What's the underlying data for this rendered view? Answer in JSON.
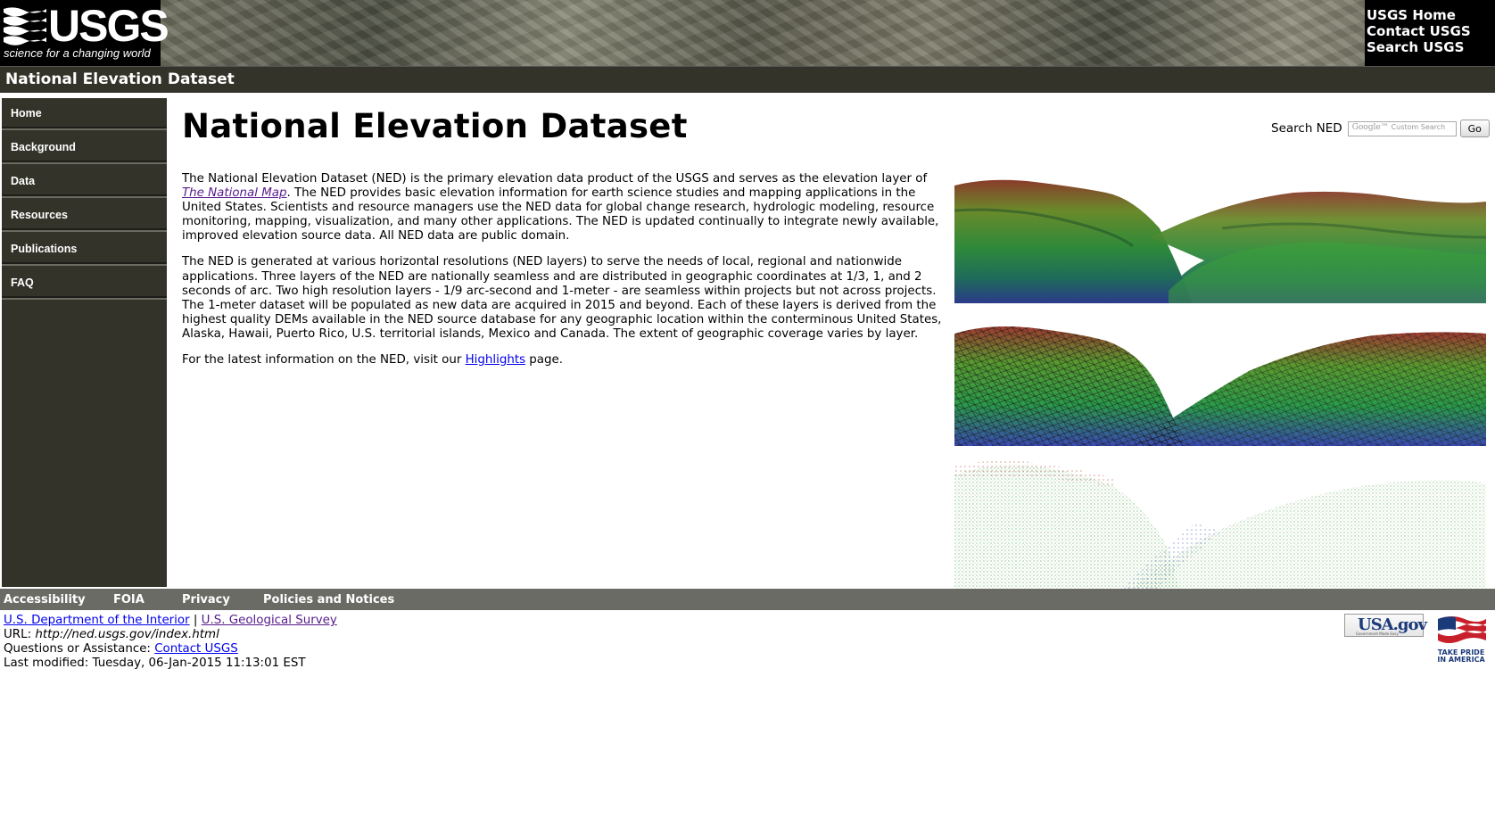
{
  "header": {
    "logo_wordmark": "USGS",
    "logo_tagline": "science for a changing world",
    "links": [
      "USGS Home",
      "Contact USGS",
      "Search USGS"
    ]
  },
  "site_title": "National Elevation Dataset",
  "nav": [
    "Home",
    "Background",
    "Data",
    "Resources",
    "Publications",
    "FAQ"
  ],
  "main": {
    "title": "National Elevation Dataset",
    "search": {
      "label": "Search NED",
      "placeholder_brand": "Google™",
      "placeholder_text": "Custom Search",
      "go_label": "Go"
    },
    "para1": {
      "before_link": "The National Elevation Dataset (NED) is the primary elevation data product of the USGS and serves as the elevation layer of ",
      "link": "The National Map",
      "after_link": ". The NED provides basic elevation information for earth science studies and mapping applications in the United States. Scientists and resource managers use the NED data for global change research, hydrologic modeling, resource monitoring, mapping, visualization, and many other applications. The NED is updated continually to integrate newly available, improved elevation source data. All NED data are public domain."
    },
    "para2": "The NED is generated at various horizontal resolutions (NED layers) to serve the needs of local, regional and nationwide applications. Three layers of the NED are nationally seamless and are distributed in geographic coordinates at 1/3, 1, and 2 seconds of arc. Two high resolution layers - 1/9 arc-second and 1-meter - are seamless within projects but not across projects. The 1-meter dataset will be populated as new data are acquired in 2015 and beyond. Each of these layers is derived from the highest quality DEMs available in the NED source database for any geographic location within the conterminous United States, Alaska, Hawaii, Puerto Rico, U.S. territorial islands, Mexico and Canada. The extent of geographic coverage varies by layer.",
    "para3": {
      "before_link": "For the latest information on the NED, visit our ",
      "link": "Highlights",
      "after_link": " page."
    }
  },
  "footer": {
    "links": [
      "Accessibility",
      "FOIA",
      "Privacy",
      "Policies and Notices"
    ],
    "doi_link": "U.S. Department of the Interior",
    "separator": "|",
    "usgs_link": "U.S. Geological Survey",
    "url_label": "URL: ",
    "url_value": "http://ned.usgs.gov/index.html",
    "questions_label": "Questions or Assistance: ",
    "contact_link": "Contact USGS",
    "modified": "Last modified: Tuesday, 06-Jan-2015 11:13:01 EST",
    "usagov_logo": "USA.gov",
    "usagov_sub": "Government Made Easy",
    "pride_logo": "TAKE PRIDE IN AMERICA"
  },
  "colors": {
    "banner_dark": "#000000",
    "titlebar": "#333329",
    "sidebar": "#333329",
    "footer_bar": "#6b6b66",
    "link": "#0000ee",
    "visited_link": "#551a8b"
  },
  "icons": [
    "usgs-logo-icon",
    "usagov-logo",
    "take-pride-logo"
  ]
}
